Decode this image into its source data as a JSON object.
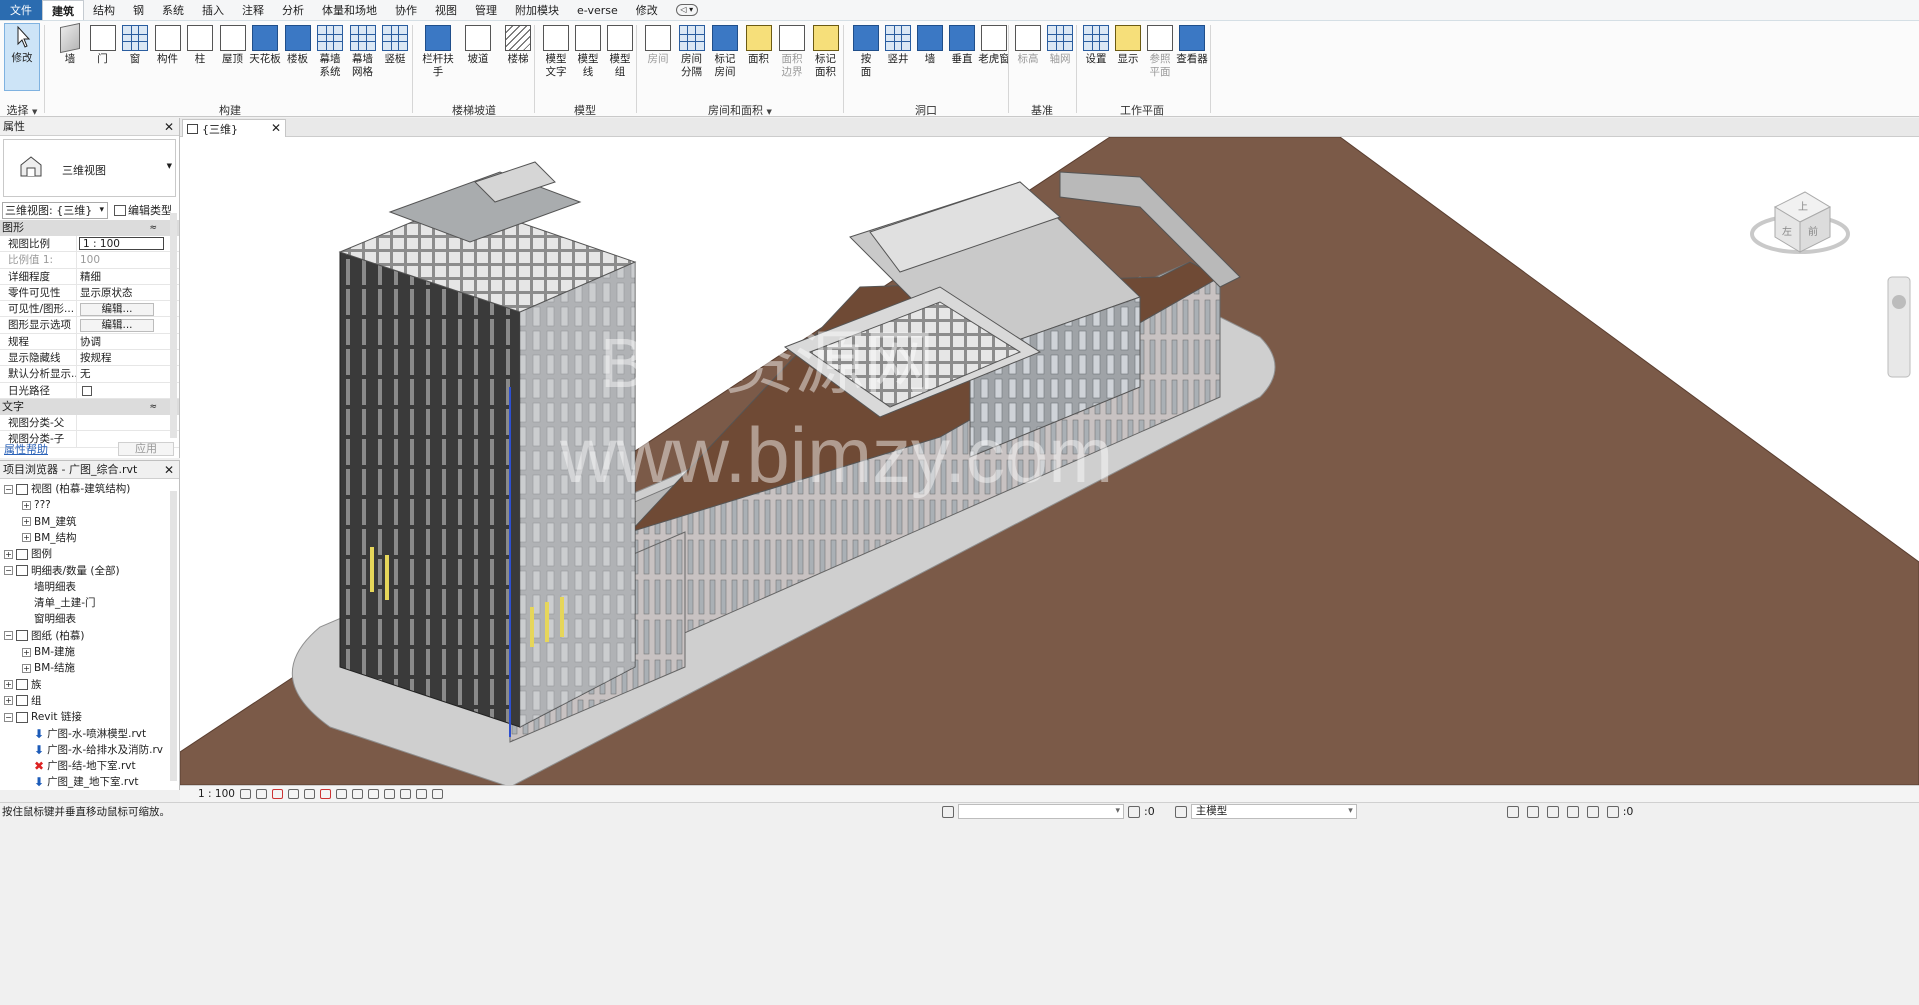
{
  "tabs": [
    "文件",
    "建筑",
    "结构",
    "钢",
    "系统",
    "插入",
    "注释",
    "分析",
    "体量和场地",
    "协作",
    "视图",
    "管理",
    "附加模块",
    "e-verse",
    "修改"
  ],
  "ribbon": {
    "select": {
      "modify": "修改",
      "select": "选择"
    },
    "build": {
      "title": "构建",
      "items": [
        "墙",
        "门",
        "窗",
        "构件",
        "柱",
        "屋顶",
        "天花板",
        "楼板",
        "幕墙\n系统",
        "幕墙\n网格",
        "竖梃"
      ]
    },
    "circulation": {
      "title": "楼梯坡道",
      "items": [
        "栏杆扶手",
        "坡道",
        "楼梯"
      ]
    },
    "model": {
      "title": "模型",
      "items": [
        "模型\n文字",
        "模型\n线",
        "模型\n组"
      ]
    },
    "room": {
      "title": "房间和面积",
      "items": [
        "房间",
        "房间\n分隔",
        "标记\n房间",
        "面积",
        "面积\n边界",
        "标记\n面积"
      ]
    },
    "opening": {
      "title": "洞口",
      "items": [
        "按\n面",
        "竖井",
        "墙",
        "垂直",
        "老虎窗"
      ]
    },
    "datum": {
      "title": "基准",
      "items": [
        "标高",
        "轴网"
      ]
    },
    "workplane": {
      "title": "工作平面",
      "items": [
        "设置",
        "显示",
        "参照\n平面",
        "查看器"
      ]
    }
  },
  "properties": {
    "title": "属性",
    "type_name": "三维视图",
    "selector": "三维视图: {三维}",
    "edit_type": "编辑类型",
    "section_graphics": "图形",
    "rows": [
      {
        "k": "视图比例",
        "v": "1 : 100"
      },
      {
        "k": "比例值 1:",
        "v": "100"
      },
      {
        "k": "详细程度",
        "v": "精细"
      },
      {
        "k": "零件可见性",
        "v": "显示原状态"
      },
      {
        "k": "可见性/图形...",
        "v": "编辑..."
      },
      {
        "k": "图形显示选项",
        "v": "编辑..."
      },
      {
        "k": "规程",
        "v": "协调"
      },
      {
        "k": "显示隐藏线",
        "v": "按规程"
      },
      {
        "k": "默认分析显示...",
        "v": "无"
      },
      {
        "k": "日光路径",
        "v": ""
      }
    ],
    "section_text": "文字",
    "text_rows": [
      {
        "k": "视图分类-父",
        "v": ""
      },
      {
        "k": "视图分类-子",
        "v": ""
      }
    ],
    "help": "属性帮助",
    "apply": "应用"
  },
  "browser": {
    "title": "项目浏览器 - 广图_综合.rvt",
    "items": [
      {
        "label": "视图 (柏慕-建筑结构)",
        "level": 0,
        "pm": "−",
        "icon": "views-icon"
      },
      {
        "label": "???",
        "level": 1,
        "pm": "+"
      },
      {
        "label": "BM_建筑",
        "level": 1,
        "pm": "+"
      },
      {
        "label": "BM_结构",
        "level": 1,
        "pm": "+"
      },
      {
        "label": "图例",
        "level": 0,
        "pm": "+",
        "icon": "legend-icon"
      },
      {
        "label": "明细表/数量 (全部)",
        "level": 0,
        "pm": "−",
        "icon": "schedule-icon"
      },
      {
        "label": "墙明细表",
        "level": 1
      },
      {
        "label": "清单_土建-门",
        "level": 1
      },
      {
        "label": "窗明细表",
        "level": 1
      },
      {
        "label": "图纸 (柏慕)",
        "level": 0,
        "pm": "−",
        "icon": "sheet-icon"
      },
      {
        "label": "BM-建施",
        "level": 1,
        "pm": "+"
      },
      {
        "label": "BM-结施",
        "level": 1,
        "pm": "+"
      },
      {
        "label": "族",
        "level": 0,
        "pm": "+",
        "icon": "family-icon"
      },
      {
        "label": "组",
        "level": 0,
        "pm": "+",
        "icon": "group-icon"
      },
      {
        "label": "Revit 链接",
        "level": 0,
        "pm": "−",
        "icon": "link-icon"
      },
      {
        "label": "广图-水-喷淋模型.rvt",
        "level": 1,
        "mark": "arrow"
      },
      {
        "label": "广图-水-给排水及消防.rv",
        "level": 1,
        "mark": "arrow"
      },
      {
        "label": "广图-结-地下室.rvt",
        "level": 1,
        "mark": "x"
      },
      {
        "label": "广图_建_地下室.rvt",
        "level": 1,
        "mark": "arrow"
      }
    ]
  },
  "view": {
    "tab": "{三维}",
    "scale": "1 : 100",
    "viewcube_top": "上",
    "viewcube_left": "左",
    "viewcube_front": "前",
    "watermark1": "BIM资源网",
    "watermark2": "www.bimzy.com"
  },
  "status": {
    "message": "按住鼠标键并垂直移动鼠标可缩放。",
    "sel_count": ":0",
    "model": "主模型",
    "filter_count": ":0"
  },
  "colors": {
    "file_tab": "#2b6cb0",
    "ground": "#7b5a48",
    "tower_dark": "#3f3f3f"
  }
}
